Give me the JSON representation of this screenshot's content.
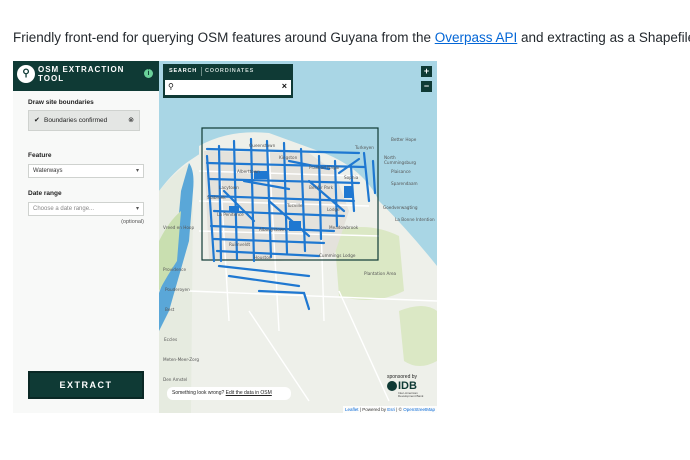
{
  "intro": {
    "before": "Friendly front-end for querying OSM features around Guyana from the ",
    "link": "Overpass API",
    "after": " and extracting as a Shapefile."
  },
  "sidebar": {
    "title": "OSM EXTRACTION TOOL",
    "boundaries_label": "Draw site boundaries",
    "boundaries_status": "Boundaries confirmed",
    "feature_label": "Feature",
    "feature_value": "Waterways",
    "date_label": "Date range",
    "date_placeholder": "Choose a date range...",
    "optional": "(optional)",
    "extract_button": "EXTRACT"
  },
  "map": {
    "tabs": [
      "SEARCH",
      "COORDINATES"
    ],
    "active_tab": "SEARCH",
    "search_value": "",
    "zoom_in": "+",
    "zoom_out": "−",
    "wrong_text": "Something look wrong?",
    "wrong_link": "Edit the data in OSM",
    "sponsored_by": "sponsored by",
    "sponsor_name": "IDB",
    "sponsor_sub": "Inter-American Development Bank",
    "attribution": {
      "leaflet": "Leaflet",
      "powered": " | Powered by ",
      "esri": "Esri",
      "sep": " | © ",
      "osm": "OpenStreetMap"
    },
    "place_labels": [
      "Kingston",
      "Alberttown",
      "North Cummingsburg",
      "Bel Air Park",
      "Lodge",
      "Tucville",
      "Plantation Area",
      "Vreed en Hoop",
      "Providence",
      "Eccles",
      "Queenstown",
      "La Penitence",
      "Albouystown",
      "Ruimveldt",
      "Sophia",
      "Prashad Nagar",
      "Lacytown",
      "Stabroek",
      "Houston",
      "Meadowbrook",
      "Better Hope",
      "Plaisance",
      "Turkeyen",
      "Sparendaam",
      "Goedverwagting",
      "La Bonne Intention",
      "Cummings Lodge",
      "Pouderoyen",
      "Best",
      "Meten-Meer-Zorg",
      "Den Amstel"
    ]
  },
  "colors": {
    "brand": "#0f3a35",
    "accent": "#6ad19a",
    "water": "#a9d6e5",
    "river": "#5aa7d8",
    "waterway": "#1f78d1",
    "land": "#eef0ea",
    "green": "#dbe8c5"
  },
  "icons": {
    "logo": "pin-logo-icon",
    "info": "info-icon",
    "check": "check-icon",
    "clear": "clear-circle-icon",
    "chevron": "chevron-down-icon",
    "search": "search-icon",
    "close": "close-icon"
  }
}
